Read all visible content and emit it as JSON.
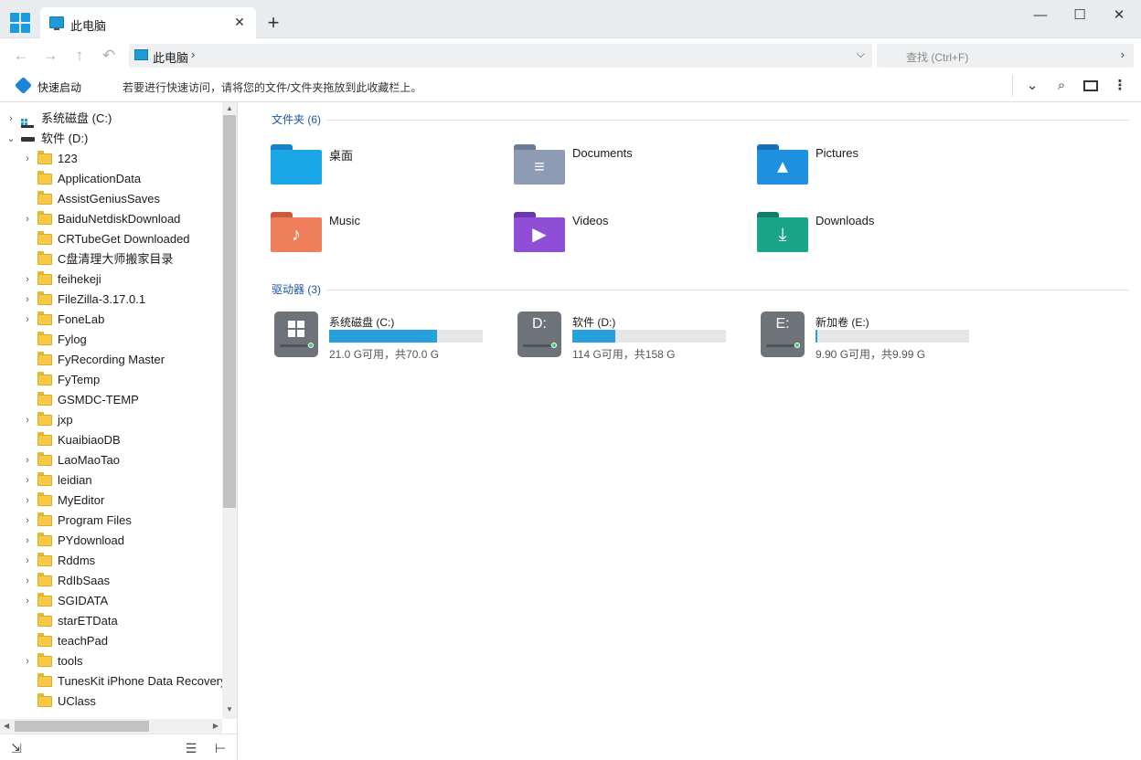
{
  "tab": {
    "title": "此电脑",
    "close": "✕"
  },
  "new_tab": "+",
  "window": {
    "minimize": "—",
    "maximize": "☐",
    "close": "✕"
  },
  "nav": {
    "back": "←",
    "forward": "→",
    "up": "↑",
    "undo": "↶"
  },
  "address": {
    "crumb": "此电脑",
    "arrow": "›",
    "dropdown": "⌵"
  },
  "search": {
    "placeholder": "查找 (Ctrl+F)",
    "go": "›"
  },
  "quick": {
    "label": "快速启动",
    "hint": "若要进行快速访问，请将您的文件/文件夹拖放到此收藏栏上。"
  },
  "toolbar": {
    "expand": "⌄",
    "search": "⌕",
    "more": "⋮"
  },
  "tree": [
    {
      "label": "系统磁盘 (C:)",
      "level": 0,
      "chev": "›",
      "kind": "drive-c"
    },
    {
      "label": "软件 (D:)",
      "level": 0,
      "chev": "⌄",
      "kind": "drive-d"
    },
    {
      "label": "123",
      "level": 1,
      "chev": "›",
      "kind": "folder"
    },
    {
      "label": "ApplicationData",
      "level": 1,
      "chev": "",
      "kind": "folder"
    },
    {
      "label": "AssistGeniusSaves",
      "level": 1,
      "chev": "",
      "kind": "folder"
    },
    {
      "label": "BaiduNetdiskDownload",
      "level": 1,
      "chev": "›",
      "kind": "folder"
    },
    {
      "label": "CRTubeGet Downloaded",
      "level": 1,
      "chev": "",
      "kind": "folder"
    },
    {
      "label": "C盘清理大师搬家目录",
      "level": 1,
      "chev": "",
      "kind": "folder"
    },
    {
      "label": "feihekeji",
      "level": 1,
      "chev": "›",
      "kind": "folder"
    },
    {
      "label": "FileZilla-3.17.0.1",
      "level": 1,
      "chev": "›",
      "kind": "folder"
    },
    {
      "label": "FoneLab",
      "level": 1,
      "chev": "›",
      "kind": "folder"
    },
    {
      "label": "Fylog",
      "level": 1,
      "chev": "",
      "kind": "folder"
    },
    {
      "label": "FyRecording Master",
      "level": 1,
      "chev": "",
      "kind": "folder"
    },
    {
      "label": "FyTemp",
      "level": 1,
      "chev": "",
      "kind": "folder"
    },
    {
      "label": "GSMDC-TEMP",
      "level": 1,
      "chev": "",
      "kind": "folder"
    },
    {
      "label": "jxp",
      "level": 1,
      "chev": "›",
      "kind": "folder"
    },
    {
      "label": "KuaibiaoDB",
      "level": 1,
      "chev": "",
      "kind": "folder"
    },
    {
      "label": "LaoMaoTao",
      "level": 1,
      "chev": "›",
      "kind": "folder"
    },
    {
      "label": "leidian",
      "level": 1,
      "chev": "›",
      "kind": "folder"
    },
    {
      "label": "MyEditor",
      "level": 1,
      "chev": "›",
      "kind": "folder"
    },
    {
      "label": "Program Files",
      "level": 1,
      "chev": "›",
      "kind": "folder"
    },
    {
      "label": "PYdownload",
      "level": 1,
      "chev": "›",
      "kind": "folder"
    },
    {
      "label": "Rddms",
      "level": 1,
      "chev": "›",
      "kind": "folder"
    },
    {
      "label": "RdIbSaas",
      "level": 1,
      "chev": "›",
      "kind": "folder"
    },
    {
      "label": "SGIDATA",
      "level": 1,
      "chev": "›",
      "kind": "folder"
    },
    {
      "label": "starETData",
      "level": 1,
      "chev": "",
      "kind": "folder"
    },
    {
      "label": "teachPad",
      "level": 1,
      "chev": "",
      "kind": "folder"
    },
    {
      "label": "tools",
      "level": 1,
      "chev": "›",
      "kind": "folder"
    },
    {
      "label": "TunesKit iPhone Data Recovery",
      "level": 1,
      "chev": "",
      "kind": "folder"
    },
    {
      "label": "UClass",
      "level": 1,
      "chev": "",
      "kind": "folder"
    }
  ],
  "sidebar_footer": {
    "collapse": "⇲",
    "outdent": "☰",
    "tree": "⊢"
  },
  "groups": {
    "folders": "文件夹 (6)",
    "drives": "驱动器 (3)"
  },
  "folders": [
    {
      "name": "桌面",
      "color": "#1aa7e8",
      "tab_color": "#1683c9",
      "glyph": ""
    },
    {
      "name": "Documents",
      "color": "#8d9bb5",
      "tab_color": "#6b7a96",
      "glyph": "≡"
    },
    {
      "name": "Pictures",
      "color": "#1e90e0",
      "tab_color": "#1670b8",
      "glyph": "▲"
    },
    {
      "name": "Music",
      "color": "#ef7f5a",
      "tab_color": "#c95a3f",
      "glyph": "♪"
    },
    {
      "name": "Videos",
      "color": "#8e4fd6",
      "tab_color": "#6c34ad",
      "glyph": "▶"
    },
    {
      "name": "Downloads",
      "color": "#1aa58a",
      "tab_color": "#137c68",
      "glyph": "⤓"
    }
  ],
  "drives": [
    {
      "name": "系统磁盘 (C:)",
      "letter": "",
      "windows": true,
      "info": "21.0 G可用，共70.0 G",
      "used_fraction": 0.7
    },
    {
      "name": "软件 (D:)",
      "letter": "D:",
      "windows": false,
      "info": "114 G可用，共158 G",
      "used_fraction": 0.28
    },
    {
      "name": "新加卷 (E:)",
      "letter": "E:",
      "windows": false,
      "info": "9.90 G可用，共9.99 G",
      "used_fraction": 0.01
    }
  ]
}
